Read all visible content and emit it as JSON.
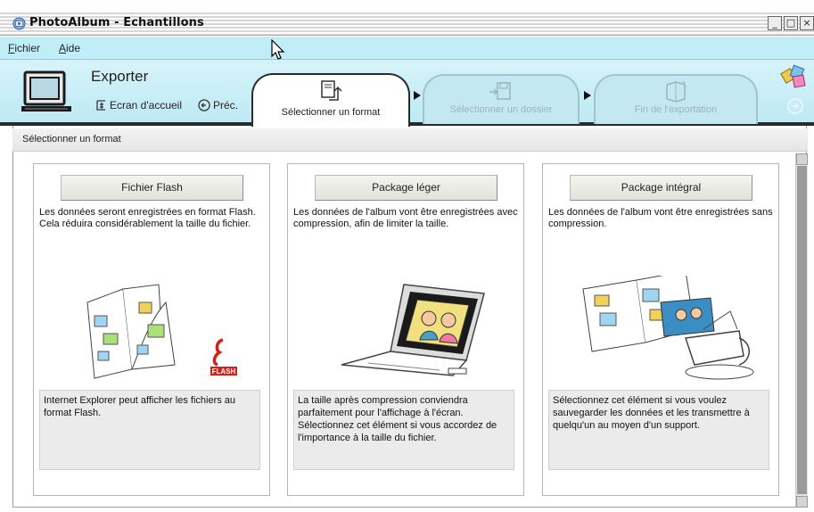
{
  "window": {
    "title": "PhotoAlbum - Echantillons",
    "minimize": "_",
    "maximize": "□",
    "close": "×"
  },
  "menu": {
    "items": [
      {
        "accel": "F",
        "rest": "ichier"
      },
      {
        "accel": "A",
        "rest": "ide"
      }
    ]
  },
  "header": {
    "title": "Exporter",
    "home_label": "Ecran d'accueil",
    "prev_label": "Préc."
  },
  "steps": [
    {
      "label": "Sélectionner un format",
      "state": "active",
      "icon": "format-icon"
    },
    {
      "label": "Sélectionner un dossier",
      "state": "disabled",
      "icon": "folder-save-icon"
    },
    {
      "label": "Fin de l'exportation",
      "state": "disabled",
      "icon": "export-finish-icon"
    }
  ],
  "section": {
    "heading": "Sélectionner un format"
  },
  "options": [
    {
      "button": "Fichier Flash",
      "description": "Les données seront enregistrées en format Flash. Cela réduira considérablement la taille du fichier.",
      "note": "Internet Explorer peut afficher les fichiers au format Flash.",
      "illustration": "flash-book-illustration",
      "flash_logo": "FLASH"
    },
    {
      "button": "Package léger",
      "description": "Les données de l'album vont être enregistrées avec compression, afin de limiter la taille.",
      "note": "La taille après compression conviendra parfaitement pour l'affichage à l'écran. Sélectionnez cet élément si vous accordez de l'importance à la taille du fichier.",
      "illustration": "laptop-photo-illustration"
    },
    {
      "button": "Package intégral",
      "description": "Les données de l'album vont être enregistrées sans compression.",
      "note": "Sélectionnez cet élément si vous voulez sauvegarder les données et les transmettre à quelqu'un au moyen d'un support.",
      "illustration": "album-printer-illustration"
    }
  ],
  "colors": {
    "menubar": "#bfeef8",
    "header": "#c6ecf6",
    "panel_note": "#ebebeb"
  }
}
